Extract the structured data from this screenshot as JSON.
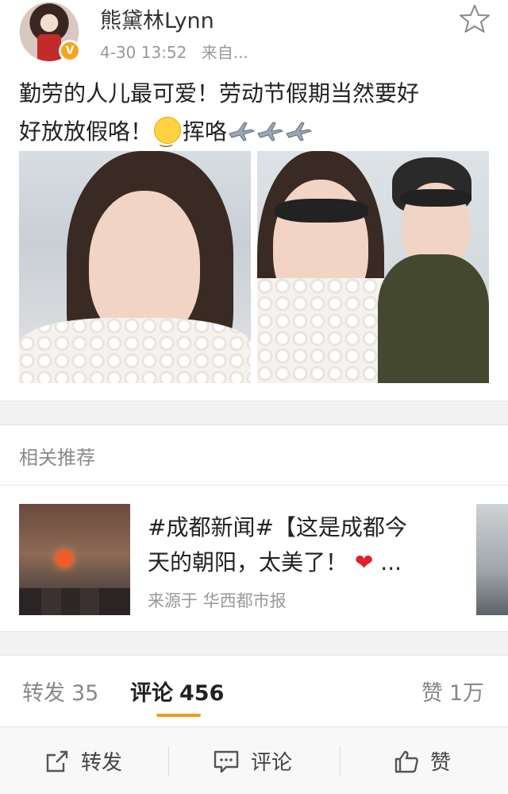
{
  "post": {
    "username": "熊黛林Lynn",
    "timestamp": "4-30 13:52",
    "source": "来自...",
    "text_line1": "勤劳的人儿最可爱！劳动节假期当然要好",
    "text_line2_start": "好放放假咯！",
    "text_line2_end": "挥咯",
    "verified_badge": "V",
    "icons": [
      "favorite-star-icon",
      "smile-emoji-icon",
      "airplane-icon"
    ]
  },
  "related": {
    "title": "相关推荐",
    "card_text_line1": "#成都新闻#【这是成都今",
    "card_text_line2": "天的朝阳，太美了！",
    "card_heart": "❤",
    "card_ellipsis": "...",
    "card_source": "来源于 华西都市报"
  },
  "tabs": {
    "reposts_label": "转发",
    "reposts_count": "35",
    "comments_label": "评论",
    "comments_count": "456",
    "likes_label": "赞",
    "likes_count": "1万"
  },
  "actions": {
    "repost": "转发",
    "comment": "评论",
    "like": "赞"
  },
  "colors": {
    "accent": "#f39a17",
    "badge": "#f7a41b",
    "heart": "#e0202f"
  }
}
